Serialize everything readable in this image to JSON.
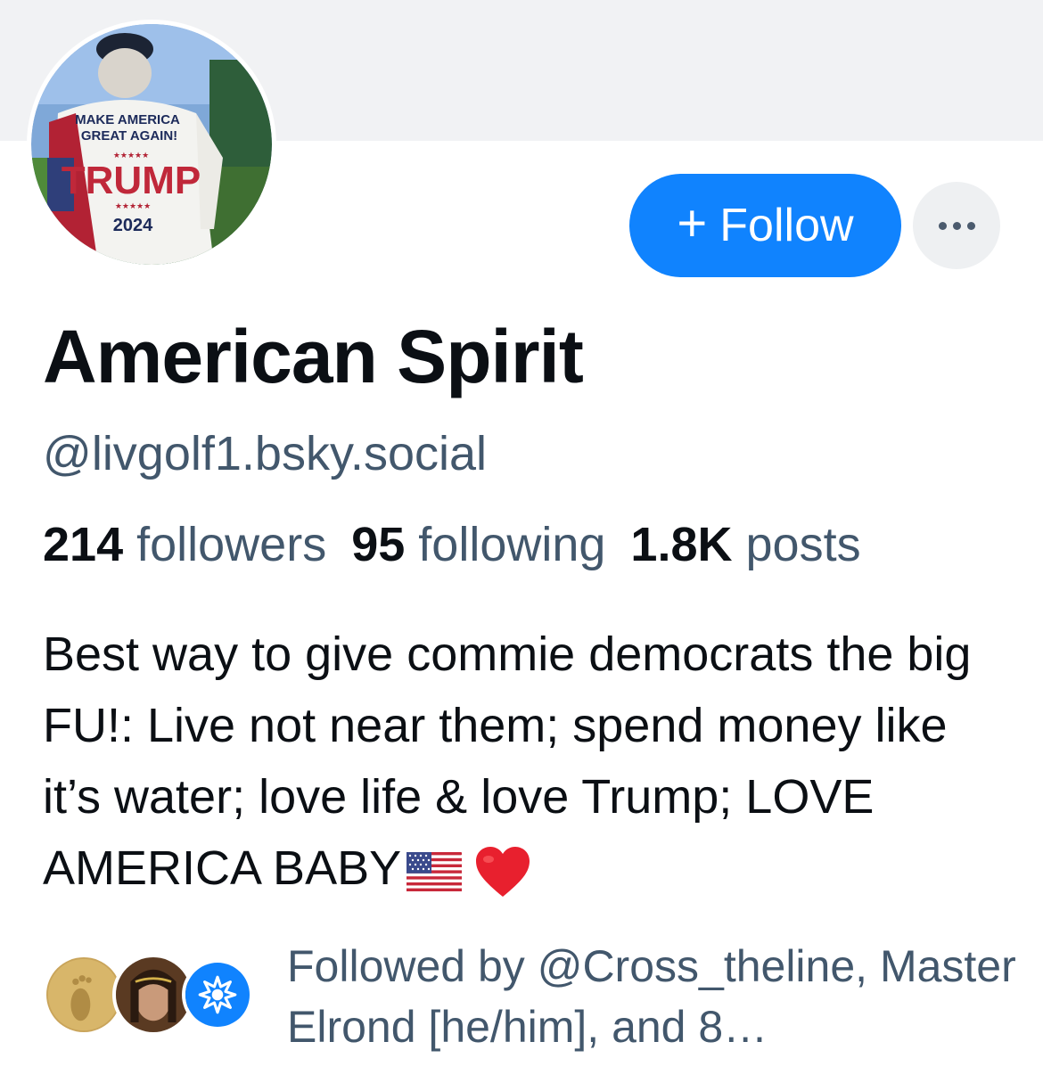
{
  "profile": {
    "display_name": "American Spirit",
    "handle": "@livgolf1.bsky.social",
    "avatar_text": {
      "line1": "MAKE AMERICA",
      "line2": "GREAT AGAIN!",
      "name": "TRUMP",
      "year": "2024"
    }
  },
  "actions": {
    "follow_plus": "+",
    "follow_label": "Follow",
    "more_icon": "ellipsis-icon"
  },
  "stats": {
    "followers_count": "214",
    "followers_label": "followers",
    "following_count": "95",
    "following_label": "following",
    "posts_count": "1.8K",
    "posts_label": "posts"
  },
  "bio": {
    "text": "Best way to give commie democrats the big FU!: Live not near them; spend money like it’s water; love life & love Trump; LOVE AMERICA BABY",
    "emojis": [
      "us-flag-icon",
      "red-heart-icon"
    ]
  },
  "followed_by": {
    "text": "Followed by @Cross_theline, Master Elrond [he/him], and 8…",
    "avatars": [
      "footprint-avatar",
      "elrond-avatar",
      "bluesky-default-avatar"
    ],
    "colors": {
      "default_avatar": "#1083fe"
    }
  },
  "colors": {
    "accent": "#1083fe",
    "muted_text": "#42576c",
    "banner": "#f1f2f4"
  }
}
